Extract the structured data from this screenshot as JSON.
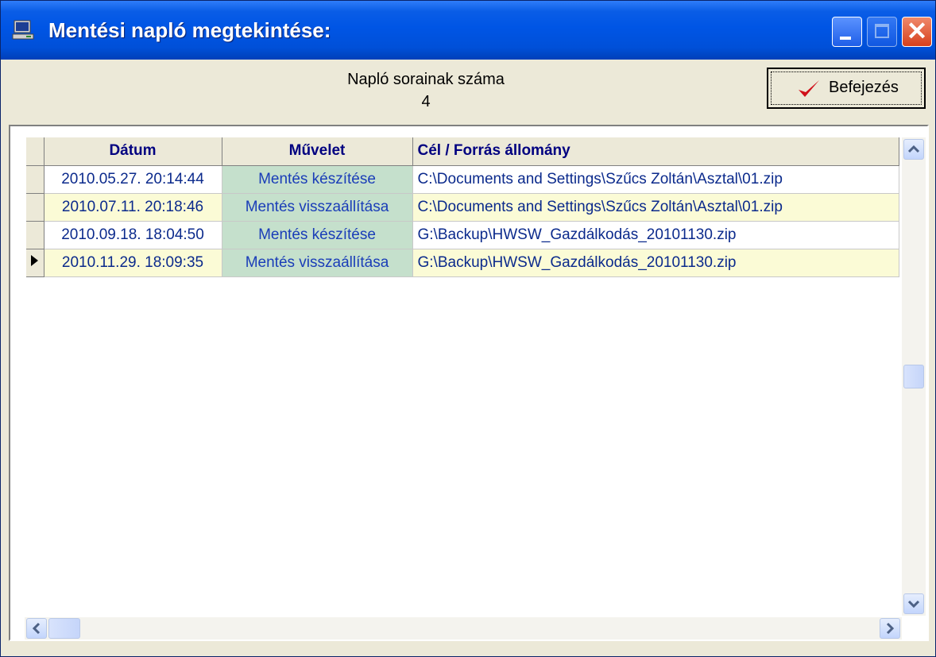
{
  "window": {
    "title": "Mentési napló megtekintése:",
    "icon": "computer-icon"
  },
  "info": {
    "label": "Napló sorainak száma",
    "count": "4"
  },
  "finish_button": {
    "label": "Befejezés",
    "icon": "checkmark-icon"
  },
  "grid": {
    "columns": [
      "Dátum",
      "Művelet",
      "Cél / Forrás állomány"
    ],
    "rows": [
      {
        "date": "2010.05.27. 20:14:44",
        "op": "Mentés készítése",
        "path": "C:\\Documents and Settings\\Szűcs Zoltán\\Asztal\\01.zip"
      },
      {
        "date": "2010.07.11. 20:18:46",
        "op": "Mentés visszaállítása",
        "path": "C:\\Documents and Settings\\Szűcs Zoltán\\Asztal\\01.zip"
      },
      {
        "date": "2010.09.18. 18:04:50",
        "op": "Mentés készítése",
        "path": "G:\\Backup\\HWSW_Gazdálkodás_20101130.zip"
      },
      {
        "date": "2010.11.29. 18:09:35",
        "op": "Mentés visszaállítása",
        "path": "G:\\Backup\\HWSW_Gazdálkodás_20101130.zip"
      }
    ],
    "current_row": 4
  },
  "colors": {
    "titlebar": "#0055e5",
    "op_cell_bg": "#c5e0cc",
    "alt_row_bg": "#fbfbd6",
    "text_blue": "#0b2a8c"
  }
}
